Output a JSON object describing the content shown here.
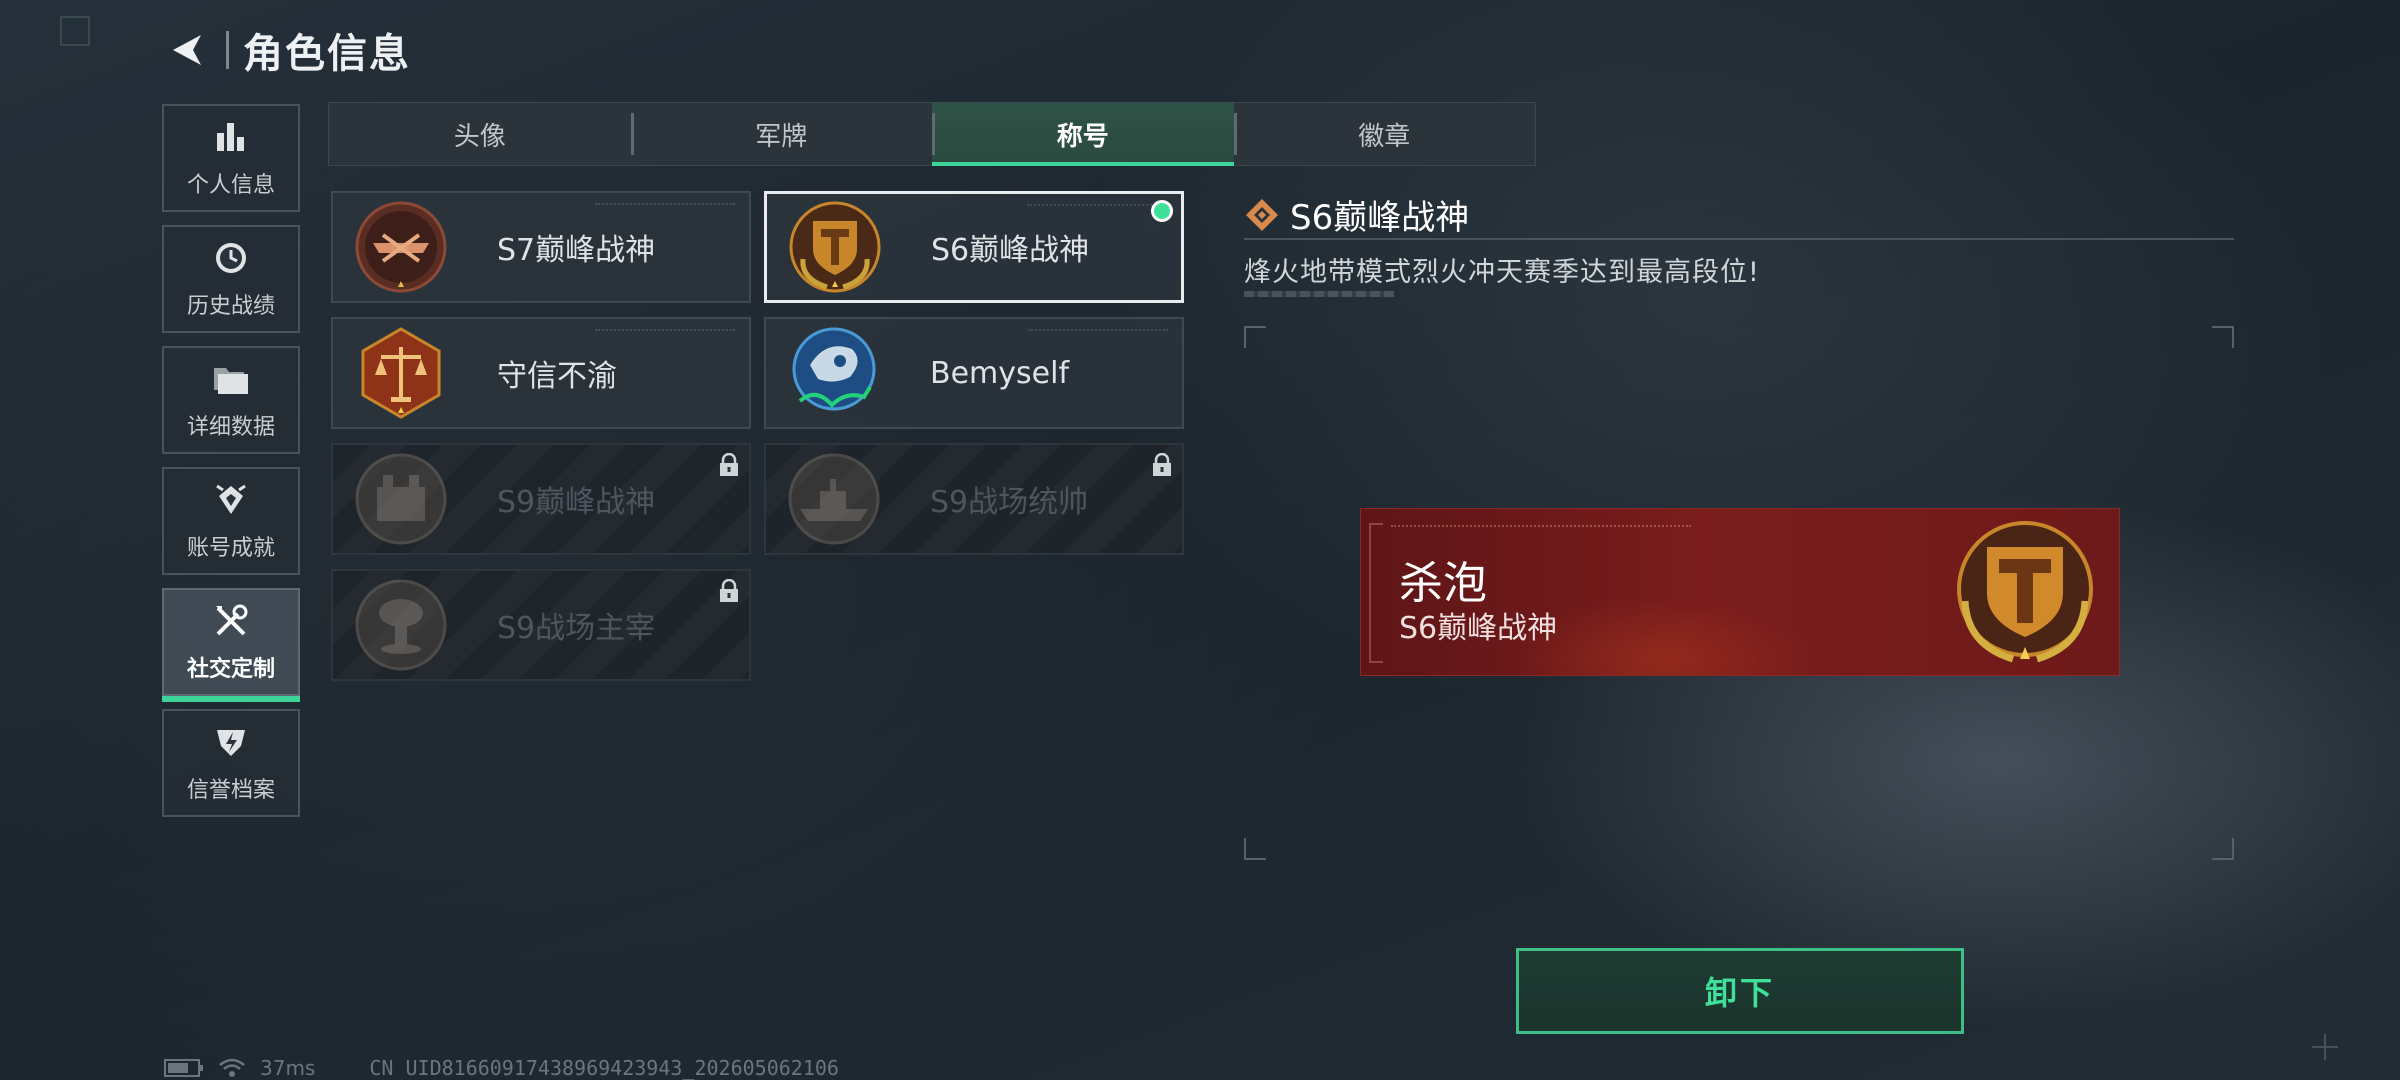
{
  "header": {
    "title": "角色信息"
  },
  "sidebar": {
    "items": [
      {
        "label": "个人信息",
        "icon": "bar-chart-icon"
      },
      {
        "label": "历史战绩",
        "icon": "history-clock-icon"
      },
      {
        "label": "详细数据",
        "icon": "folder-icon"
      },
      {
        "label": "账号成就",
        "icon": "achievement-icon"
      },
      {
        "label": "社交定制",
        "icon": "tools-icon",
        "active": true
      },
      {
        "label": "信誉档案",
        "icon": "credit-shield-icon"
      }
    ]
  },
  "tabs": [
    {
      "label": "头像"
    },
    {
      "label": "军牌"
    },
    {
      "label": "称号",
      "active": true
    },
    {
      "label": "徽章"
    }
  ],
  "titles": [
    {
      "name": "S7巅峰战神",
      "locked": false,
      "selected": false
    },
    {
      "name": "S6巅峰战神",
      "locked": false,
      "selected": true
    },
    {
      "name": "守信不渝",
      "locked": false,
      "selected": false
    },
    {
      "name": "Bemyself",
      "locked": false,
      "selected": false
    },
    {
      "name": "S9巅峰战神",
      "locked": true,
      "selected": false
    },
    {
      "name": "S9战场统帅",
      "locked": true,
      "selected": false
    },
    {
      "name": "S9战场主宰",
      "locked": true,
      "selected": false
    }
  ],
  "detail": {
    "title": "S6巅峰战神",
    "description": "烽火地带模式烈火冲天赛季达到最高段位!"
  },
  "banner": {
    "player_name": "杀泡",
    "title": "S6巅峰战神"
  },
  "actions": {
    "unequip_label": "卸下"
  },
  "status": {
    "ping": "37ms",
    "uid": "CN UID8166091743896942394​3_202605062106"
  },
  "colors": {
    "accent": "#3fd59a",
    "banner_red": "#7a1c1c",
    "gold": "#c8862a"
  }
}
